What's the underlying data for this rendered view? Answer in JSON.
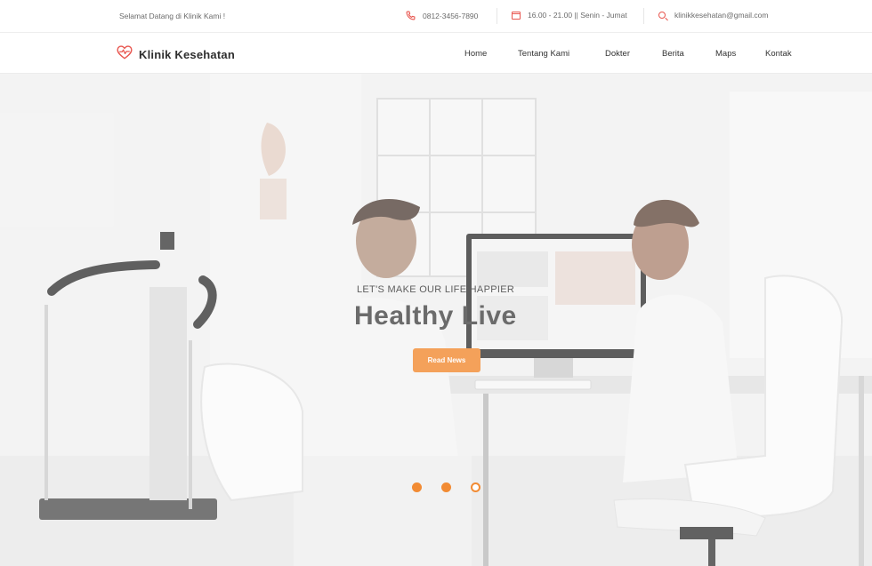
{
  "topbar": {
    "welcome": "Selamat Datang di Klinik Kami !",
    "phone": "0812-3456-7890",
    "hours": "16.00 - 21.00 || Senin - Jumat",
    "email": "klinikkesehatan@gmail.com"
  },
  "brand": {
    "name": "Klinik Kesehatan",
    "logo_icon": "heart-pulse-icon"
  },
  "nav": {
    "items": [
      "Home",
      "Tentang Kami",
      "Dokter",
      "Berita",
      "Maps",
      "Kontak"
    ]
  },
  "hero": {
    "eyebrow": "LET'S MAKE OUR LIFE HAPPIER",
    "headline": "Healthy Live",
    "cta_label": "Read News",
    "slide_count": 3,
    "active_slide": 3
  },
  "colors": {
    "accent": "#f28b33",
    "icon": "#e8554e",
    "brand_text": "#2f2f2f"
  }
}
